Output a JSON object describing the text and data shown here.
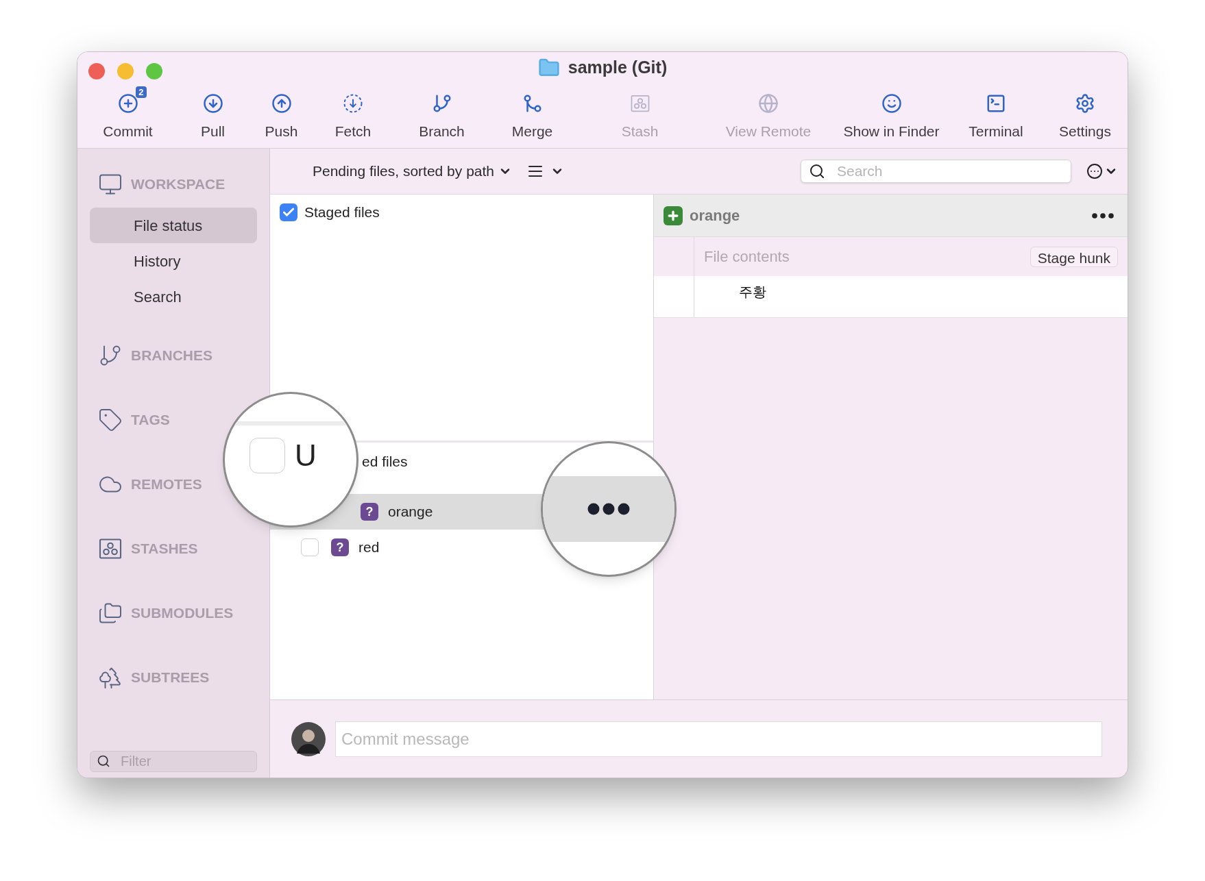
{
  "window": {
    "title": "sample (Git)"
  },
  "toolbar": [
    {
      "label": "Commit",
      "kind": "commit",
      "disabled": false,
      "badge": "2"
    },
    {
      "label": "Pull",
      "kind": "pull",
      "disabled": false
    },
    {
      "label": "Push",
      "kind": "push",
      "disabled": false
    },
    {
      "label": "Fetch",
      "kind": "fetch",
      "disabled": false
    },
    {
      "label": "Branch",
      "kind": "branch",
      "disabled": false
    },
    {
      "label": "Merge",
      "kind": "merge",
      "disabled": false
    },
    {
      "label": "Stash",
      "kind": "stash",
      "disabled": true
    },
    {
      "label": "View Remote",
      "kind": "remote",
      "disabled": true
    },
    {
      "label": "Show in Finder",
      "kind": "finder",
      "disabled": false
    },
    {
      "label": "Terminal",
      "kind": "terminal",
      "disabled": false
    },
    {
      "label": "Settings",
      "kind": "settings",
      "disabled": false
    }
  ],
  "sidebar": {
    "sections": [
      {
        "label": "WORKSPACE",
        "kind": "workspace",
        "items": [
          {
            "label": "File status",
            "selected": true
          },
          {
            "label": "History",
            "selected": false
          },
          {
            "label": "Search",
            "selected": false
          }
        ]
      },
      {
        "label": "BRANCHES",
        "kind": "branches"
      },
      {
        "label": "TAGS",
        "kind": "tags"
      },
      {
        "label": "REMOTES",
        "kind": "remotes"
      },
      {
        "label": "STASHES",
        "kind": "stashes"
      },
      {
        "label": "SUBMODULES",
        "kind": "submodules"
      },
      {
        "label": "SUBTREES",
        "kind": "subtrees"
      }
    ],
    "filter": {
      "placeholder": "Filter"
    }
  },
  "file_list": {
    "sort_label": "Pending files, sorted by path",
    "search": {
      "placeholder": "Search"
    },
    "staged": {
      "label": "Staged files",
      "checked": true
    },
    "unstaged": {
      "label": "ed files"
    },
    "files": [
      {
        "name": "orange",
        "selected": true,
        "status": "?"
      },
      {
        "name": "red",
        "selected": false,
        "checked": false,
        "status": "?"
      }
    ]
  },
  "magnifiers": [
    {
      "kind": "checkbox-label",
      "checked": false,
      "text": "U"
    },
    {
      "kind": "more"
    }
  ],
  "diff": {
    "file": "orange",
    "hunk_label": "File contents",
    "stage_button": "Stage hunk",
    "lines": [
      "주황"
    ]
  },
  "commit": {
    "placeholder": "Commit message"
  }
}
